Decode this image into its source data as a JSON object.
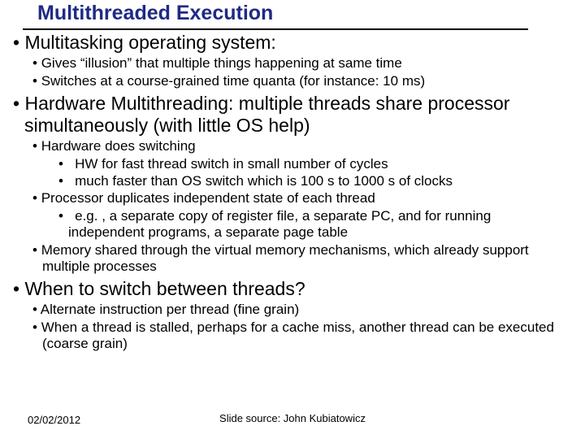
{
  "title": "Multithreaded Execution",
  "bullets": {
    "b1": "Multitasking operating system:",
    "b1a": "Gives “illusion” that multiple things happening at same time",
    "b1b": "Switches at a course-grained time quanta (for instance: 10 ms)",
    "b2": "Hardware Multithreading: multiple threads share processor simultaneously (with little OS help)",
    "b2a": "Hardware does switching",
    "b2a1": "HW for fast thread switch in small number of cycles",
    "b2a2": "much faster than OS switch which is 100 s to 1000 s of clocks",
    "b2b": "Processor duplicates independent state of each thread",
    "b2b1": "e.g. , a separate copy of register file, a separate PC, and for running independent programs, a separate page table",
    "b2c": "Memory shared through the virtual memory mechanisms, which already support multiple processes",
    "b3": "When to switch between threads?",
    "b3a": "Alternate instruction per thread (fine grain)",
    "b3b": "When a thread is stalled, perhaps for a cache miss, another thread can be executed (coarse grain)"
  },
  "footer": {
    "date": "02/02/2012",
    "source": "Slide source: John Kubiatowicz"
  }
}
